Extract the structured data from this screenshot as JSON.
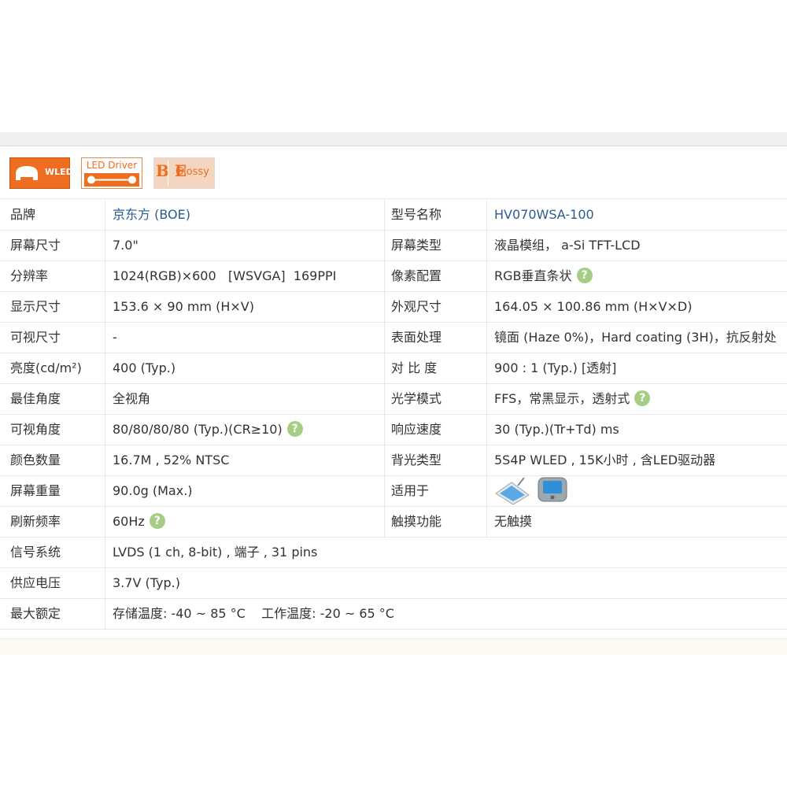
{
  "badges": {
    "wled": "WLED",
    "led_driver": "LED Driver",
    "glossy": "Glossy",
    "glossy_mark": "B E"
  },
  "spec": {
    "brand_key": "品牌",
    "brand_val": "京东方 (BOE)",
    "model_key": "型号名称",
    "model_val": "HV070WSA-100",
    "size_key": "屏幕尺寸",
    "size_val": "7.0\"",
    "type_key": "屏幕类型",
    "type_val": "液晶模组， a-Si TFT-LCD",
    "res_key": "分辨率",
    "res_val": "1024(RGB)×600   [WSVGA]  169PPI",
    "pixel_key": "像素配置",
    "pixel_val": "RGB垂直条状",
    "disp_key": "显示尺寸",
    "disp_val": "153.6 × 90 mm (H×V)",
    "outline_key": "外观尺寸",
    "outline_val": "164.05 × 100.86 mm (H×V×D)",
    "view_key": "可视尺寸",
    "view_val": "-",
    "surface_key": "表面处理",
    "surface_val": "镜面 (Haze 0%)，Hard coating (3H)，抗反射处",
    "lum_key": "亮度(cd/m²)",
    "lum_val": "400 (Typ.)",
    "contrast_key": "对 比 度",
    "contrast_val": "900 : 1 (Typ.) [透射]",
    "best_key": "最佳角度",
    "best_val": "全视角",
    "optical_key": "光学模式",
    "optical_val": "FFS，常黑显示，透射式",
    "angle_key": "可视角度",
    "angle_val": "80/80/80/80 (Typ.)(CR≥10)",
    "resp_key": "响应速度",
    "resp_val": "30 (Typ.)(Tr+Td) ms",
    "color_key": "颜色数量",
    "color_val": "16.7M , 52% NTSC",
    "backlight_key": "背光类型",
    "backlight_val": "5S4P WLED , 15K小时 , 含LED驱动器",
    "weight_key": "屏幕重量",
    "weight_val": "90.0g (Max.)",
    "apply_key": "适用于",
    "refresh_key": "刷新频率",
    "refresh_val": "60Hz",
    "touch_key": "触摸功能",
    "touch_val": "无触摸",
    "signal_key": "信号系统",
    "signal_val": "LVDS (1 ch, 8-bit) , 端子 , 31 pins",
    "voltage_key": "供应电压",
    "voltage_val": "3.7V (Typ.)",
    "max_key": "最大额定",
    "max_val": "存储温度: -40 ~ 85 °C    工作温度: -20 ~ 65 °C"
  },
  "help_glyph": "?",
  "colors": {
    "accent": "#ee6d1f",
    "link": "#2c5b8e",
    "help": "#a6cd84"
  },
  "icons": [
    "wled-icon",
    "led-driver-icon",
    "glossy-icon",
    "help-icon",
    "tablet-icon",
    "handheld-device-icon"
  ]
}
